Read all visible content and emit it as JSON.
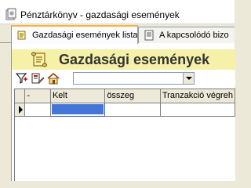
{
  "window": {
    "title": "Pénztárkönyv - gazdasági események"
  },
  "tabs": [
    {
      "label": "Gazdasági események lista",
      "active": true
    },
    {
      "label": "A kapcsolódó bizo",
      "active": false
    }
  ],
  "header": {
    "title": "Gazdasági események"
  },
  "toolbar": {
    "filter_select": {
      "value": ""
    }
  },
  "grid": {
    "columns": [
      "-",
      "Kelt",
      "összeg",
      "Tranzakció végreh"
    ],
    "rows": [
      {
        "dash": "",
        "kelt": "",
        "osszeg": "",
        "tranzakcio": ""
      }
    ]
  },
  "colors": {
    "header_band": "#f6f1a8",
    "selection": "#4476d8",
    "active_tab_accent": "#f8b33a"
  }
}
